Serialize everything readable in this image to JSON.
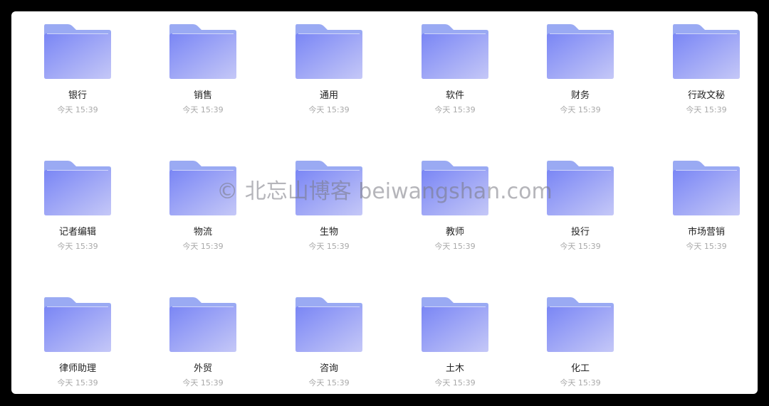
{
  "colors": {
    "background": "#000000",
    "window": "#ffffff",
    "folder_back": "#9aaaf3",
    "folder_front_start": "#7a86f5",
    "folder_front_end": "#c5c8f7",
    "folder_top_edge": "#d9defb"
  },
  "folders": [
    {
      "name": "银行",
      "date": "今天 15:39",
      "icon": "folder-icon"
    },
    {
      "name": "销售",
      "date": "今天 15:39",
      "icon": "folder-icon"
    },
    {
      "name": "通用",
      "date": "今天 15:39",
      "icon": "folder-icon"
    },
    {
      "name": "软件",
      "date": "今天 15:39",
      "icon": "folder-icon"
    },
    {
      "name": "财务",
      "date": "今天 15:39",
      "icon": "folder-icon"
    },
    {
      "name": "行政文秘",
      "date": "今天 15:39",
      "icon": "folder-icon"
    },
    {
      "name": "记者编辑",
      "date": "今天 15:39",
      "icon": "folder-icon"
    },
    {
      "name": "物流",
      "date": "今天 15:39",
      "icon": "folder-icon"
    },
    {
      "name": "生物",
      "date": "今天 15:39",
      "icon": "folder-icon"
    },
    {
      "name": "教师",
      "date": "今天 15:39",
      "icon": "folder-icon"
    },
    {
      "name": "投行",
      "date": "今天 15:39",
      "icon": "folder-icon"
    },
    {
      "name": "市场营销",
      "date": "今天 15:39",
      "icon": "folder-icon"
    },
    {
      "name": "律师助理",
      "date": "今天 15:39",
      "icon": "folder-icon"
    },
    {
      "name": "外贸",
      "date": "今天 15:39",
      "icon": "folder-icon"
    },
    {
      "name": "咨询",
      "date": "今天 15:39",
      "icon": "folder-icon"
    },
    {
      "name": "土木",
      "date": "今天 15:39",
      "icon": "folder-icon"
    },
    {
      "name": "化工",
      "date": "今天 15:39",
      "icon": "folder-icon"
    }
  ],
  "watermark": "© 北忘山博客 beiwangshan.com"
}
